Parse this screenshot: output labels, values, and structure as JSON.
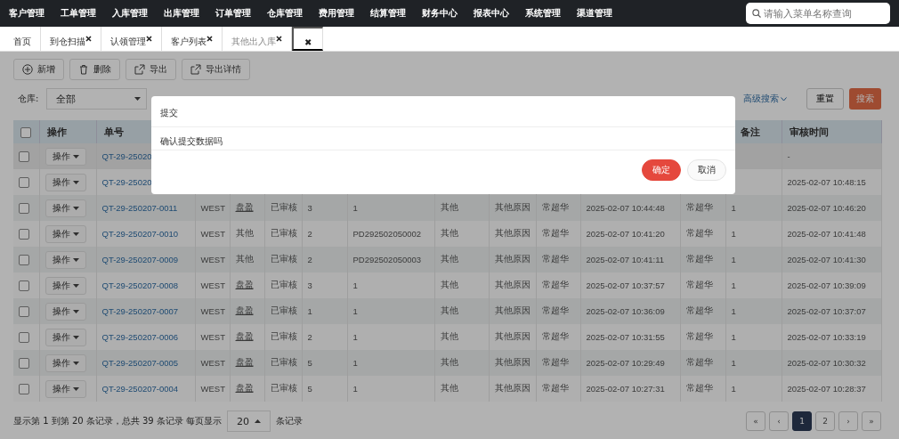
{
  "top_nav": {
    "items": [
      "客户管理",
      "工单管理",
      "入库管理",
      "出库管理",
      "订单管理",
      "仓库管理",
      "费用管理",
      "结算管理",
      "财务中心",
      "报表中心",
      "系统管理",
      "渠道管理"
    ],
    "search": {
      "placeholder": "请输入菜单名称查询"
    }
  },
  "tabs": [
    {
      "label": "首页",
      "selected": false,
      "closable": false
    },
    {
      "label": "到仓扫描",
      "selected": false,
      "closable": true
    },
    {
      "label": "认领管理",
      "selected": false,
      "closable": true
    },
    {
      "label": "客户列表",
      "selected": false,
      "closable": true
    },
    {
      "label": "其他出入库",
      "selected": true,
      "closable": true
    }
  ],
  "close_all": "✖",
  "toolbar": [
    {
      "label": "新增"
    },
    {
      "label": "删除"
    },
    {
      "label": "导出"
    },
    {
      "label": "导出详情"
    }
  ],
  "filters": {
    "warehouse_label": "仓库:",
    "warehouse_value": "全部",
    "advanced": "高级搜索",
    "reset": "重置",
    "search": "搜索"
  },
  "table": {
    "select_all_checked": false,
    "columns_left": [
      "操作",
      "单号"
    ],
    "columns_right": [
      "备注",
      "审核时间"
    ],
    "rows": [
      {
        "checked": false,
        "op": "操作",
        "number": "QT-29-25020",
        "reviewed": "-"
      },
      {
        "checked": false,
        "op": "操作",
        "number": "QT-29-25020",
        "reviewed": "2025-02-07 10:48:15"
      },
      {
        "checked": false,
        "op": "操作",
        "number": "QT-29-250207-0011",
        "warehouse": "WEST",
        "type": "盘盈",
        "type_link": true,
        "status": "已审核",
        "qty": "3",
        "ref": "1",
        "category": "其他",
        "reason": "其他原因",
        "creator": "常超华",
        "created": "2025-02-07 10:44:48",
        "reviewer": "常超华",
        "remark": "1",
        "reviewed": "2025-02-07 10:46:20"
      },
      {
        "checked": false,
        "op": "操作",
        "number": "QT-29-250207-0010",
        "warehouse": "WEST",
        "type": "其他",
        "type_link": false,
        "status": "已审核",
        "qty": "2",
        "ref": "PD292502050002",
        "category": "其他",
        "reason": "其他原因",
        "creator": "常超华",
        "created": "2025-02-07 10:41:20",
        "reviewer": "常超华",
        "remark": "1",
        "reviewed": "2025-02-07 10:41:48"
      },
      {
        "checked": false,
        "op": "操作",
        "number": "QT-29-250207-0009",
        "warehouse": "WEST",
        "type": "其他",
        "type_link": false,
        "status": "已审核",
        "qty": "2",
        "ref": "PD292502050003",
        "category": "其他",
        "reason": "其他原因",
        "creator": "常超华",
        "created": "2025-02-07 10:41:11",
        "reviewer": "常超华",
        "remark": "1",
        "reviewed": "2025-02-07 10:41:30"
      },
      {
        "checked": false,
        "op": "操作",
        "number": "QT-29-250207-0008",
        "warehouse": "WEST",
        "type": "盘盈",
        "type_link": true,
        "status": "已审核",
        "qty": "3",
        "ref": "1",
        "category": "其他",
        "reason": "其他原因",
        "creator": "常超华",
        "created": "2025-02-07 10:37:57",
        "reviewer": "常超华",
        "remark": "1",
        "reviewed": "2025-02-07 10:39:09"
      },
      {
        "checked": false,
        "op": "操作",
        "number": "QT-29-250207-0007",
        "warehouse": "WEST",
        "type": "盘盈",
        "type_link": true,
        "status": "已审核",
        "qty": "1",
        "ref": "1",
        "category": "其他",
        "reason": "其他原因",
        "creator": "常超华",
        "created": "2025-02-07 10:36:09",
        "reviewer": "常超华",
        "remark": "1",
        "reviewed": "2025-02-07 10:37:07"
      },
      {
        "checked": false,
        "op": "操作",
        "number": "QT-29-250207-0006",
        "warehouse": "WEST",
        "type": "盘盈",
        "type_link": true,
        "status": "已审核",
        "qty": "2",
        "ref": "1",
        "category": "其他",
        "reason": "其他原因",
        "creator": "常超华",
        "created": "2025-02-07 10:31:55",
        "reviewer": "常超华",
        "remark": "1",
        "reviewed": "2025-02-07 10:33:19"
      },
      {
        "checked": false,
        "op": "操作",
        "number": "QT-29-250207-0005",
        "warehouse": "WEST",
        "type": "盘盈",
        "type_link": true,
        "status": "已审核",
        "qty": "5",
        "ref": "1",
        "category": "其他",
        "reason": "其他原因",
        "creator": "常超华",
        "created": "2025-02-07 10:29:49",
        "reviewer": "常超华",
        "remark": "1",
        "reviewed": "2025-02-07 10:30:32"
      },
      {
        "checked": false,
        "op": "操作",
        "number": "QT-29-250207-0004",
        "warehouse": "WEST",
        "type": "盘盈",
        "type_link": true,
        "status": "已审核",
        "qty": "5",
        "ref": "1",
        "category": "其他",
        "reason": "其他原因",
        "creator": "常超华",
        "created": "2025-02-07 10:27:31",
        "reviewer": "常超华",
        "remark": "1",
        "reviewed": "2025-02-07 10:28:37"
      }
    ]
  },
  "footer": {
    "summary": "显示第 1 到第 20 条记录，总共 39 条记录 每页显示",
    "page_size": "20",
    "page_size_suffix": "条记录",
    "pages": [
      {
        "label": "«",
        "selected": false
      },
      {
        "label": "‹",
        "selected": false
      },
      {
        "label": "1",
        "selected": true
      },
      {
        "label": "2",
        "selected": false
      },
      {
        "label": "›",
        "selected": false
      },
      {
        "label": "»",
        "selected": false
      }
    ]
  },
  "dialog": {
    "title": "提交",
    "message": "确认提交数据吗",
    "buttons": [
      {
        "label": "确定",
        "kind": "primary"
      },
      {
        "label": "取消",
        "kind": "default"
      }
    ]
  }
}
